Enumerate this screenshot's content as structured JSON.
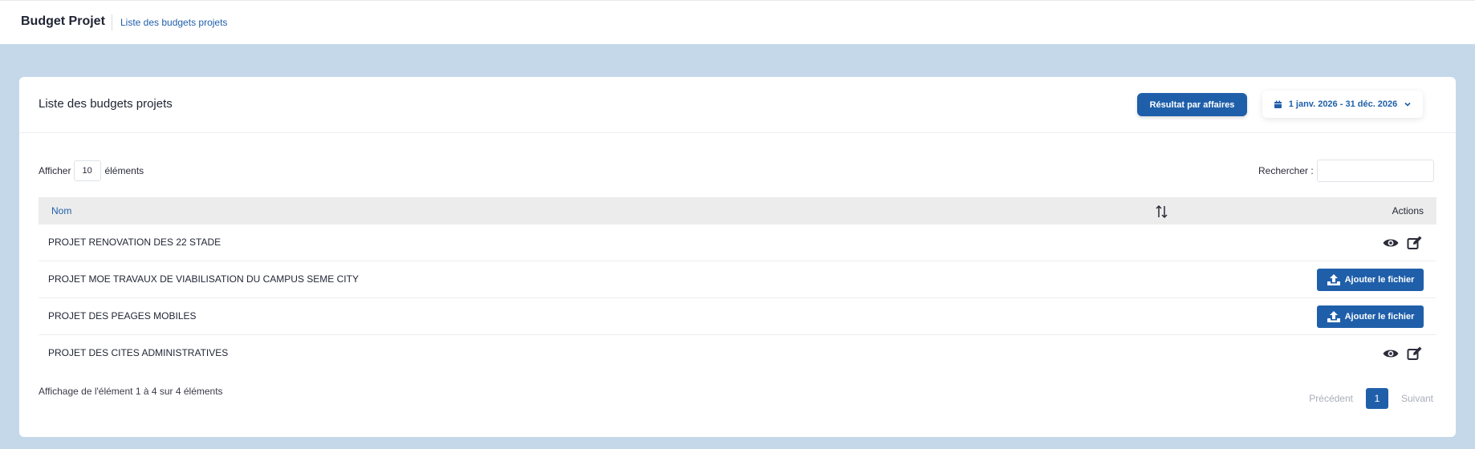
{
  "header": {
    "app_title": "Budget Projet",
    "breadcrumb": "Liste des budgets projets"
  },
  "card": {
    "title": "Liste des budgets projets",
    "result_button": "Résultat par affaires",
    "date_range": "1 janv. 2026 - 31 déc. 2026"
  },
  "controls": {
    "show_prefix": "Afficher",
    "show_value": "10",
    "show_suffix": "éléments",
    "search_label": "Rechercher :"
  },
  "table": {
    "columns": [
      "Nom",
      "Actions"
    ],
    "rows": [
      {
        "name": "PROJET RENOVATION DES 22 STADE",
        "action": "view-edit"
      },
      {
        "name": "PROJET MOE TRAVAUX DE VIABILISATION DU CAMPUS SEME CITY",
        "action": "upload"
      },
      {
        "name": "PROJET DES PEAGES MOBILES",
        "action": "upload"
      },
      {
        "name": "PROJET DES CITES ADMINISTRATIVES",
        "action": "view-edit"
      }
    ],
    "upload_label": "Ajouter le fichier"
  },
  "footer": {
    "info": "Affichage de l'élément 1 à 4 sur 4 éléments",
    "prev": "Précédent",
    "page": "1",
    "next": "Suivant"
  },
  "colors": {
    "accent": "#1f5faa",
    "background": "#c5d8ea",
    "header_row": "#ececec"
  },
  "icons": {
    "calendar": "calendar-icon",
    "chevron": "chevron-down-icon",
    "sort": "sort-icon",
    "view": "eye-icon",
    "edit": "edit-icon",
    "upload": "upload-icon"
  }
}
